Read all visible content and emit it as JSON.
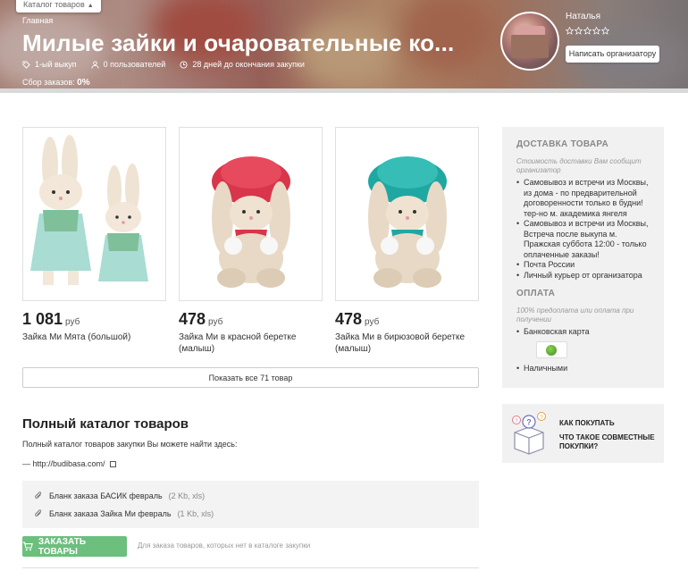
{
  "header": {
    "catalog_button": "Каталог товаров",
    "breadcrumb": "Главная",
    "title": "Милые зайки и очаровательные ко...",
    "meta": {
      "issue": "1-ый выкуп",
      "users": "0 пользователей",
      "deadline": "28 дней до окончания закупки"
    },
    "orders_label": "Сбор заказов:",
    "orders_value": "0%",
    "organizer": {
      "name": "Наталья",
      "rating_stars": 0,
      "rating_max": 5,
      "write_button": "Написать организатору"
    }
  },
  "products": [
    {
      "price": "1 081",
      "currency": "руб",
      "name": "Зайка Ми Мята (большой)"
    },
    {
      "price": "478",
      "currency": "руб",
      "name": "Зайка Ми в красной беретке (малыш)"
    },
    {
      "price": "478",
      "currency": "руб",
      "name": "Зайка Ми в бирюзовой беретке (малыш)"
    }
  ],
  "show_all_button": "Показать все 71 товар",
  "full_catalog": {
    "title": "Полный каталог товаров",
    "text": "Полный каталог товаров закупки Вы можете найти здесь:",
    "link": "— http://budibasa.com/"
  },
  "files": [
    {
      "name": "Бланк заказа БАСИК февраль",
      "size": "(2 Kb, xls)"
    },
    {
      "name": "Бланк заказа Зайка Ми февраль",
      "size": "(1 Kb, xls)"
    }
  ],
  "order_button": "ЗАКАЗАТЬ ТОВАРЫ",
  "order_note": "Для заказа товаров, которых нет в каталоге закупки",
  "sidebar": {
    "delivery_title": "ДОСТАВКА ТОВАРА",
    "delivery_note": "Стоимость доставки Вам сообщит организатор",
    "delivery_items": [
      "Самовывоз и встречи из Москвы, из дома - по предварительной договоренности только в будни! тер-но м. академика янгеля",
      "Самовывоз и встречи из Москвы, Встреча после выкупа м. Пражская суббота 12:00 - только оплаченные заказы!",
      "Почта России",
      "Личный курьер от организатора"
    ],
    "payment_title": "ОПЛАТА",
    "payment_note": "100% предоплата или оплата при получении",
    "payment_items": [
      "Банковская карта",
      "Наличными"
    ]
  },
  "howto": {
    "line1": "КАК ПОКУПАТЬ",
    "line2": "ЧТО ТАКОЕ СОВМЕСТНЫЕ ПОКУПКИ?"
  },
  "colors": {
    "accent_green": "#6cbf7d",
    "sidebar_bg": "#f1f1f1"
  }
}
